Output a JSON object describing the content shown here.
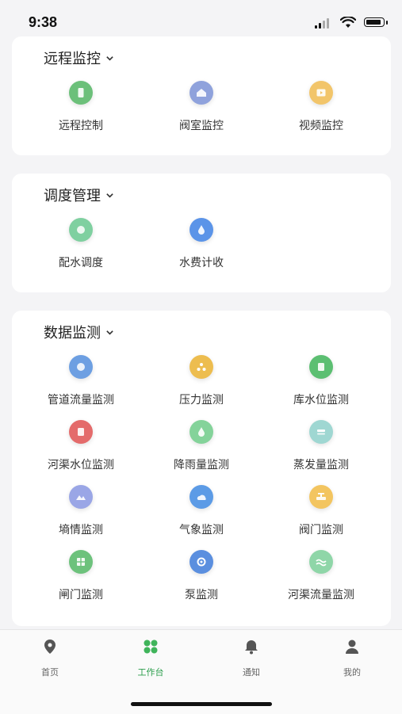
{
  "status_bar": {
    "time": "9:38"
  },
  "sections": [
    {
      "title": "远程监控",
      "items": [
        {
          "label": "远程控制",
          "icon": "phone-icon",
          "color": "#6cc07a"
        },
        {
          "label": "阀室监控",
          "icon": "house-icon",
          "color": "#8fa2dc"
        },
        {
          "label": "视频监控",
          "icon": "video-icon",
          "color": "#f2c56a"
        }
      ]
    },
    {
      "title": "调度管理",
      "items": [
        {
          "label": "配水调度",
          "icon": "dispatch-icon",
          "color": "#7fd0a0"
        },
        {
          "label": "水费计收",
          "icon": "water-fee-icon",
          "color": "#5b94e8"
        }
      ]
    },
    {
      "title": "数据监测",
      "items": [
        {
          "label": "管道流量监测",
          "icon": "pipe-flow-icon",
          "color": "#6d9fe2"
        },
        {
          "label": "压力监测",
          "icon": "pressure-icon",
          "color": "#edbd4f"
        },
        {
          "label": "库水位监测",
          "icon": "reservoir-level-icon",
          "color": "#5cbf72"
        },
        {
          "label": "河渠水位监测",
          "icon": "river-level-icon",
          "color": "#e46b6b"
        },
        {
          "label": "降雨量监测",
          "icon": "rainfall-icon",
          "color": "#84d39a"
        },
        {
          "label": "蒸发量监测",
          "icon": "evaporation-icon",
          "color": "#9fd7d2"
        },
        {
          "label": "墒情监测",
          "icon": "soil-moisture-icon",
          "color": "#9aa6e6"
        },
        {
          "label": "气象监测",
          "icon": "weather-icon",
          "color": "#5c9be6"
        },
        {
          "label": "阀门监测",
          "icon": "valve-icon",
          "color": "#f3c560"
        },
        {
          "label": "闸门监测",
          "icon": "gate-icon",
          "color": "#6dc27c"
        },
        {
          "label": "泵监测",
          "icon": "pump-icon",
          "color": "#5b8fdf"
        },
        {
          "label": "河渠流量监测",
          "icon": "river-flow-icon",
          "color": "#8fd6a8"
        }
      ]
    }
  ],
  "tabbar": {
    "items": [
      {
        "label": "首页",
        "icon": "location-pin-icon"
      },
      {
        "label": "工作台",
        "icon": "grid-icon",
        "active": true
      },
      {
        "label": "通知",
        "icon": "bell-icon"
      },
      {
        "label": "我的",
        "icon": "user-icon"
      }
    ],
    "active_color": "#2a9d4b"
  }
}
